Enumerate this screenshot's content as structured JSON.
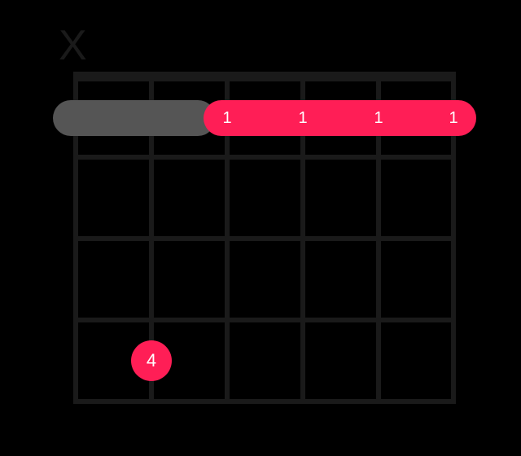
{
  "chart_data": {
    "type": "chord-diagram",
    "strings": 6,
    "frets": 4,
    "muted_strings": [
      1
    ],
    "open_strings": [],
    "barres": [
      {
        "from_string": 2,
        "to_string": 6,
        "visual_to_string": 6,
        "fret": 1,
        "finger": "1"
      }
    ],
    "barres_labeled_strings": [
      3,
      4,
      5,
      6
    ],
    "dots": [
      {
        "string": 2,
        "fret": 4,
        "finger": "4"
      }
    ],
    "colors": {
      "accent": "#ff1e56",
      "grid": "#1a1a1a",
      "barre_shadow": "#555555"
    }
  },
  "labels": {
    "mute": "X",
    "barre_finger": "1",
    "dot_finger": "4"
  }
}
